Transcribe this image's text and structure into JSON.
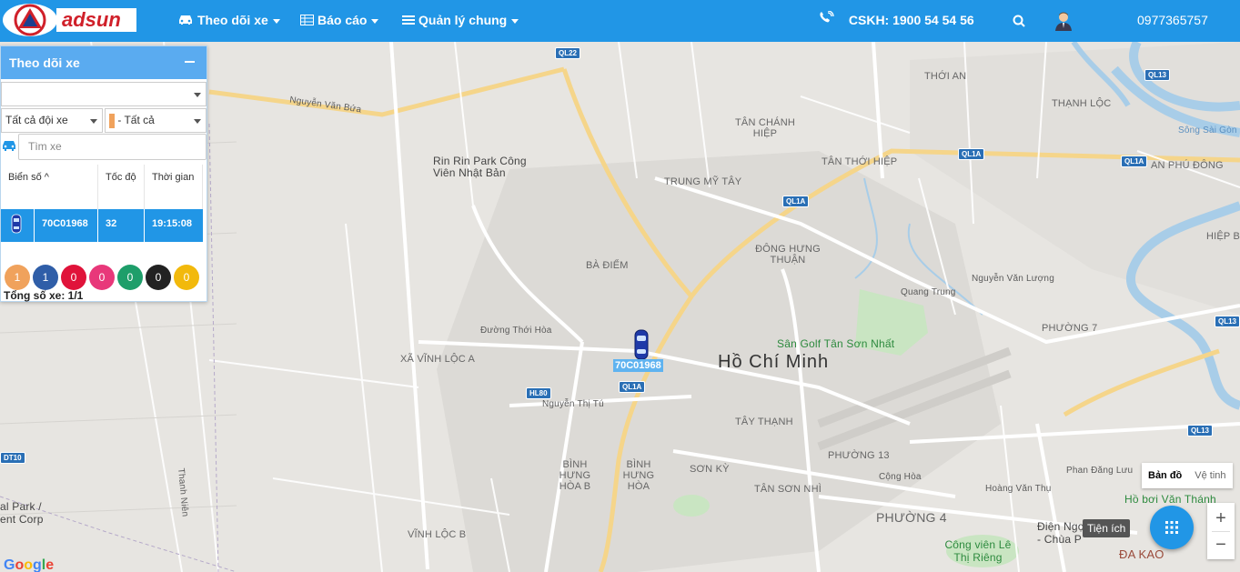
{
  "header": {
    "brand": "adsun",
    "nav": [
      {
        "label": "Theo dõi xe",
        "icon": "car-icon"
      },
      {
        "label": "Báo cáo",
        "icon": "table-icon"
      },
      {
        "label": "Quản lý chung",
        "icon": "list-icon"
      }
    ],
    "hotline": "CSKH: 1900 54 54 56",
    "phone": "0977365757"
  },
  "panel": {
    "title": "Theo dõi xe",
    "fleet_select": "Tất cả đội xe",
    "status_select": "- Tất cả",
    "search_placeholder": "Tìm xe",
    "columns": [
      "Biển số",
      "Tốc độ",
      "Thời gian"
    ],
    "rows": [
      {
        "plate": "70C01968",
        "speed": "32",
        "time": "19:15:08"
      }
    ],
    "counters": [
      {
        "value": "1",
        "color": "#f0a25c"
      },
      {
        "value": "1",
        "color": "#2f5ea8"
      },
      {
        "value": "0",
        "color": "#e0133a"
      },
      {
        "value": "0",
        "color": "#e8387a"
      },
      {
        "value": "0",
        "color": "#1e9e6a"
      },
      {
        "value": "0",
        "color": "#222222"
      },
      {
        "value": "0",
        "color": "#f2b90c"
      }
    ],
    "total": "Tổng số xe: 1/1"
  },
  "map": {
    "vehicle_label": "70C01968",
    "labels": [
      "Nguyễn Văn Bứa",
      "Rin Rin Park Công Viên Nhật Bản",
      "TRUNG MỸ TÂY",
      "TÂN CHÁNH HIỆP",
      "TÂN THỚI HIỆP",
      "THỚI AN",
      "THẠNH LỘC",
      "AN PHÚ ĐÔNG",
      "HIỆP BÌNH",
      "BÀ ĐIỂM",
      "ĐÔNG HƯNG THUẬN",
      "Sân Golf Tân Sơn Nhất",
      "Hồ Chí Minh",
      "PHƯỜNG 7",
      "XÃ VĨNH LỘC A",
      "TÂY THẠNH",
      "PHƯỜNG 13",
      "BÌNH HƯNG HÒA B",
      "BÌNH HƯNG HÒA",
      "SƠN KỲ",
      "TÂN SƠN NHÌ",
      "PHƯỜNG 4",
      "VĨNH LỘC B",
      "Công viên Lê Thị Riêng",
      "ĐA KAO",
      "Hồ bơi Văn Thánh",
      "Điện Ngọc - Chùa P",
      "Nguyễn Thị Tú",
      "Đường Thới Hòa",
      "Quang Trung",
      "Cộng Hòa",
      "Hoàng Văn Thụ",
      "Phan Đăng Lưu",
      "Nguyễn Văn Lượng",
      "Thanh Niên",
      "Sông Sài Gòn",
      "al Park / ent Corp"
    ],
    "shields": [
      "QL22",
      "QL1A",
      "QL1A",
      "QL1A",
      "QL13",
      "QL13",
      "QL13",
      "HL80",
      "QL1A",
      "DT10"
    ],
    "map_type": [
      "Bản đồ",
      "Vệ tinh"
    ],
    "utility_tip": "Tiện ích",
    "google": "Google"
  }
}
